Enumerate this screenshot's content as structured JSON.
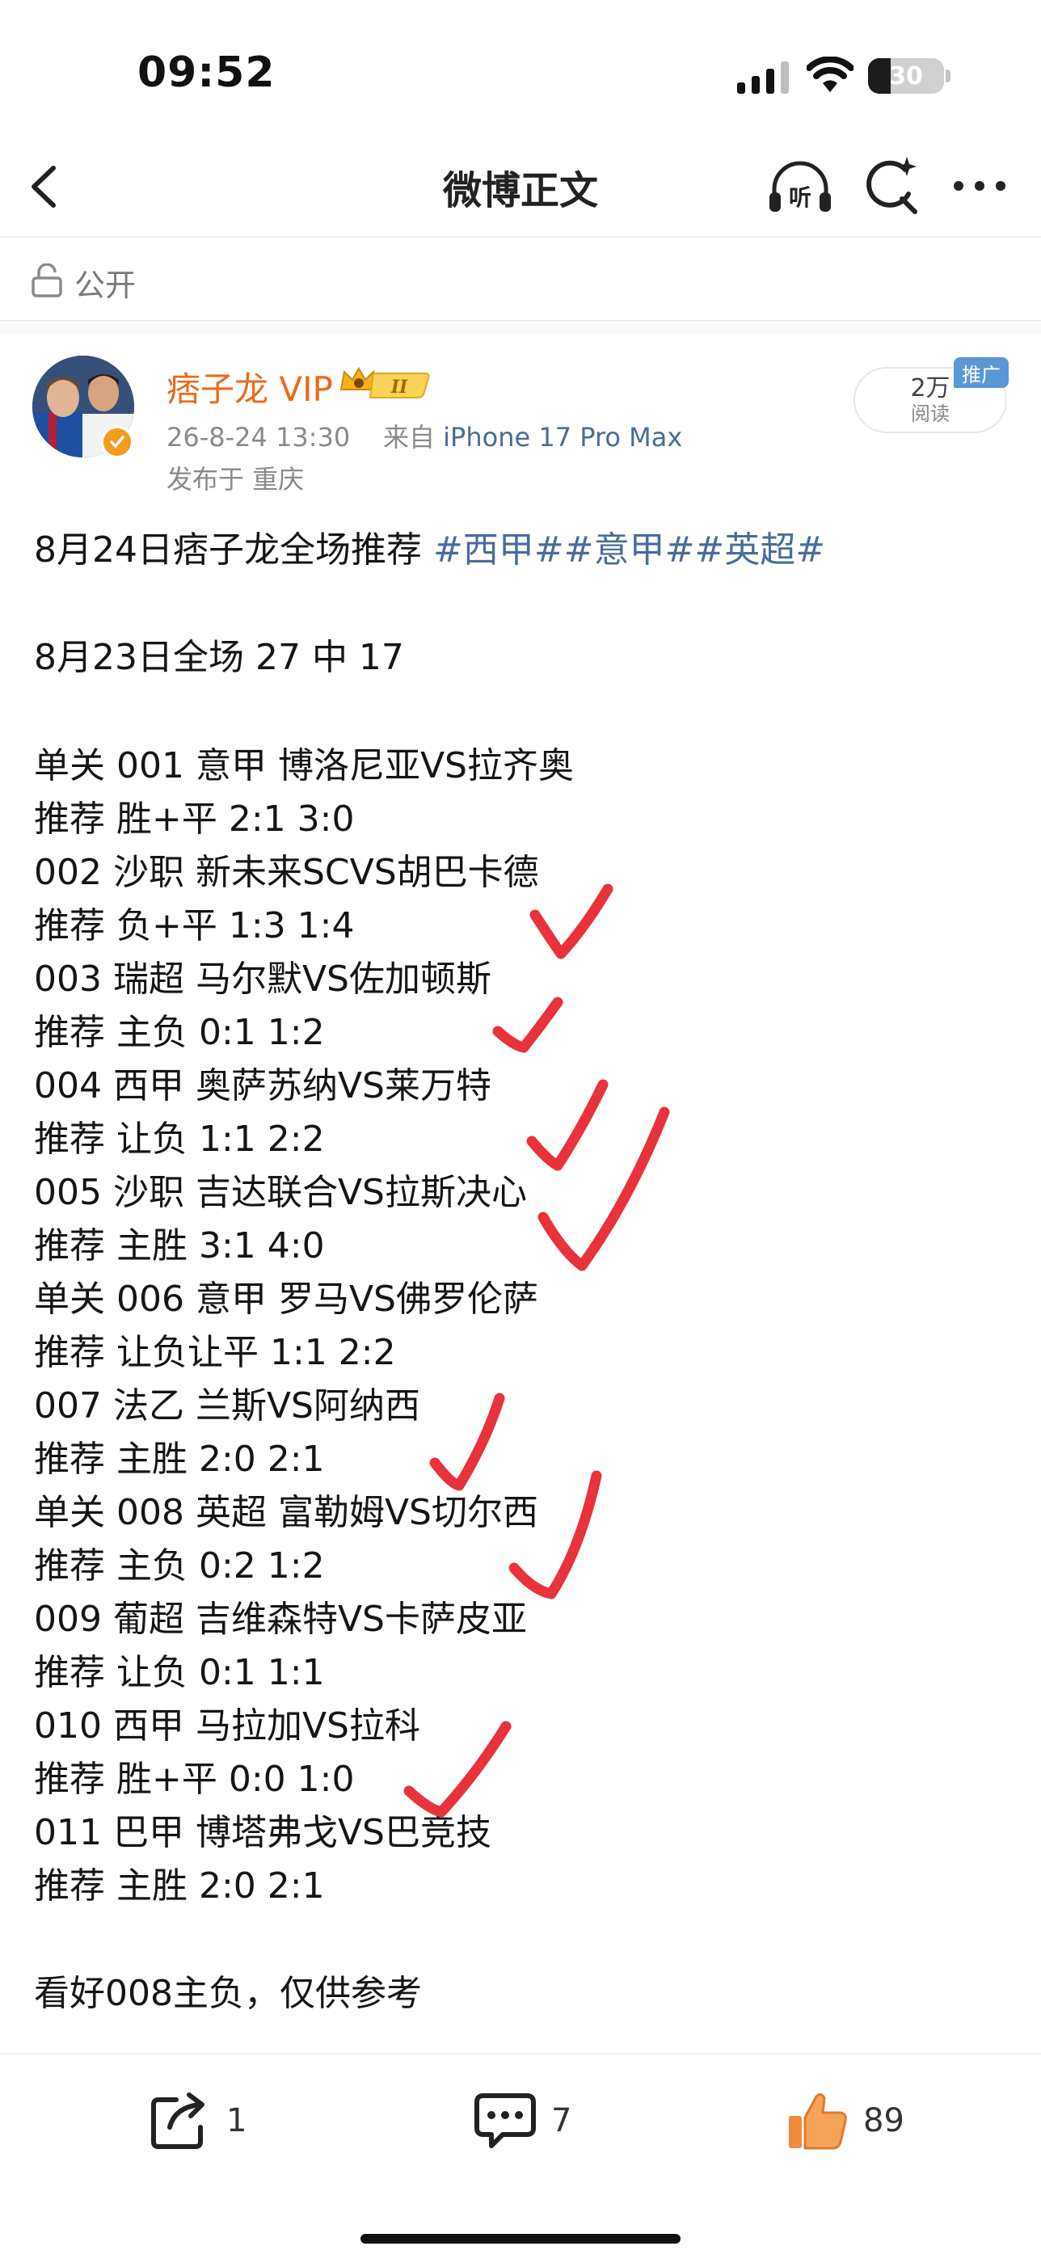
{
  "status_bar": {
    "time": "09:52",
    "battery": "30",
    "battery_level": 0.3
  },
  "nav": {
    "title": "微博正文",
    "icons": [
      "back-icon",
      "listen-icon",
      "search-icon",
      "more-icon"
    ],
    "listen_label": "听"
  },
  "visibility": {
    "label": "公开",
    "icon": "lock-icon"
  },
  "post": {
    "author": {
      "name": "痞子龙 VIP",
      "vip_level": "II",
      "verified_color": "#f39b1c"
    },
    "timestamp": "26-8-24 13:30",
    "source_prefix": "来自",
    "device": "iPhone 17 Pro Max",
    "location": "发布于 重庆",
    "reads": {
      "count": "2万",
      "label": "阅读",
      "promo": "推广"
    },
    "headline": "8月24日痞子龙全场推荐 ",
    "hashtags": "#西甲##意甲##英超#",
    "record": "8月23日全场 27 中 17",
    "picks": [
      {
        "match": "单关 001 意甲 博洛尼亚VS拉齐奥",
        "tip": "推荐 胜+平 2:1 3:0"
      },
      {
        "match": "002 沙职 新未来SCVS胡巴卡德",
        "tip": "推荐 负+平 1:3 1:4"
      },
      {
        "match": "003 瑞超 马尔默VS佐加顿斯",
        "tip": "推荐 主负 0:1 1:2"
      },
      {
        "match": "004 西甲 奥萨苏纳VS莱万特",
        "tip": "推荐 让负 1:1 2:2"
      },
      {
        "match": "005 沙职 吉达联合VS拉斯决心",
        "tip": "推荐 主胜 3:1 4:0"
      },
      {
        "match": "单关 006 意甲 罗马VS佛罗伦萨",
        "tip": "推荐 让负让平 1:1 2:2"
      },
      {
        "match": "007 法乙 兰斯VS阿纳西",
        "tip": "推荐 主胜 2:0 2:1"
      },
      {
        "match": "单关 008 英超 富勒姆VS切尔西",
        "tip": "推荐 主负 0:2 1:2"
      },
      {
        "match": "009 葡超 吉维森特VS卡萨皮亚",
        "tip": "推荐 让负 0:1 1:1"
      },
      {
        "match": "010 西甲 马拉加VS拉科",
        "tip": "推荐 胜+平 0:0 1:0"
      },
      {
        "match": "011 巴甲 博塔弗戈VS巴竞技",
        "tip": "推荐 主胜 2:0 2:1"
      }
    ],
    "closing": "看好008主负，仅供参考"
  },
  "toolbar": {
    "share_count": "1",
    "comment_count": "7",
    "like_count": "89",
    "like_color": "#f08a3c"
  },
  "accent_colors": {
    "username": "#ec6a1a",
    "link": "#4a6c9b",
    "checkmark": "#e8323c"
  }
}
